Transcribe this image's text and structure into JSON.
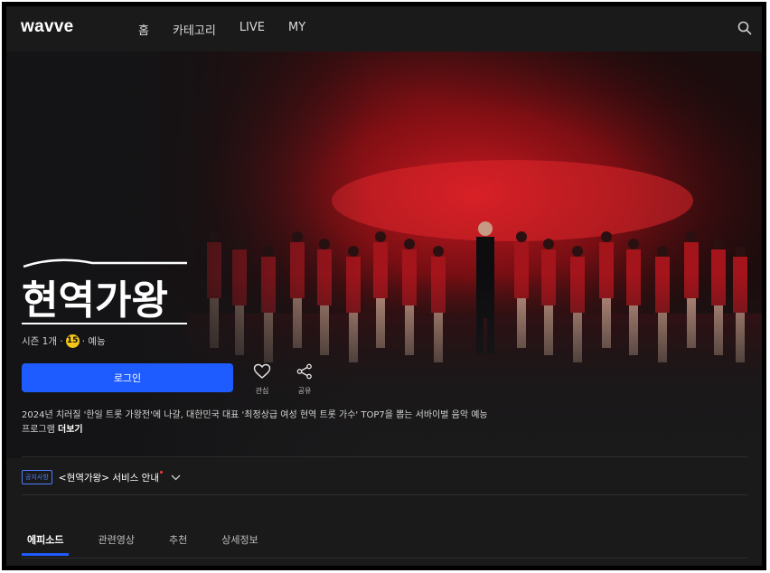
{
  "header": {
    "logo": "wavve",
    "nav": [
      "홈",
      "카테고리",
      "LIVE",
      "MY"
    ],
    "search_icon": "search-icon"
  },
  "show": {
    "title": "현역가왕",
    "meta_prefix": "시즌 1개 ·",
    "age_rating": "15",
    "meta_suffix": "· 예능",
    "login_label": "로그인",
    "actions": {
      "like_label": "관심",
      "share_label": "공유"
    },
    "description": "2024년 치러질 '한일 트롯 가왕전'에 나갈, 대한민국 대표 '최정상급 여성 현역 트롯 가수' TOP7을 뽑는 서바이벌 음악 예능 프로그램",
    "more_label": "더보기"
  },
  "notice": {
    "badge": "공지사항",
    "text": "<현역가왕> 서비스 안내"
  },
  "tabs": [
    "에피소드",
    "관련영상",
    "추천",
    "상세정보"
  ],
  "colors": {
    "accent": "#1f5cff",
    "background": "#1a1a1b",
    "age_badge": "#f5c518",
    "stage_red": "#c8141e"
  }
}
